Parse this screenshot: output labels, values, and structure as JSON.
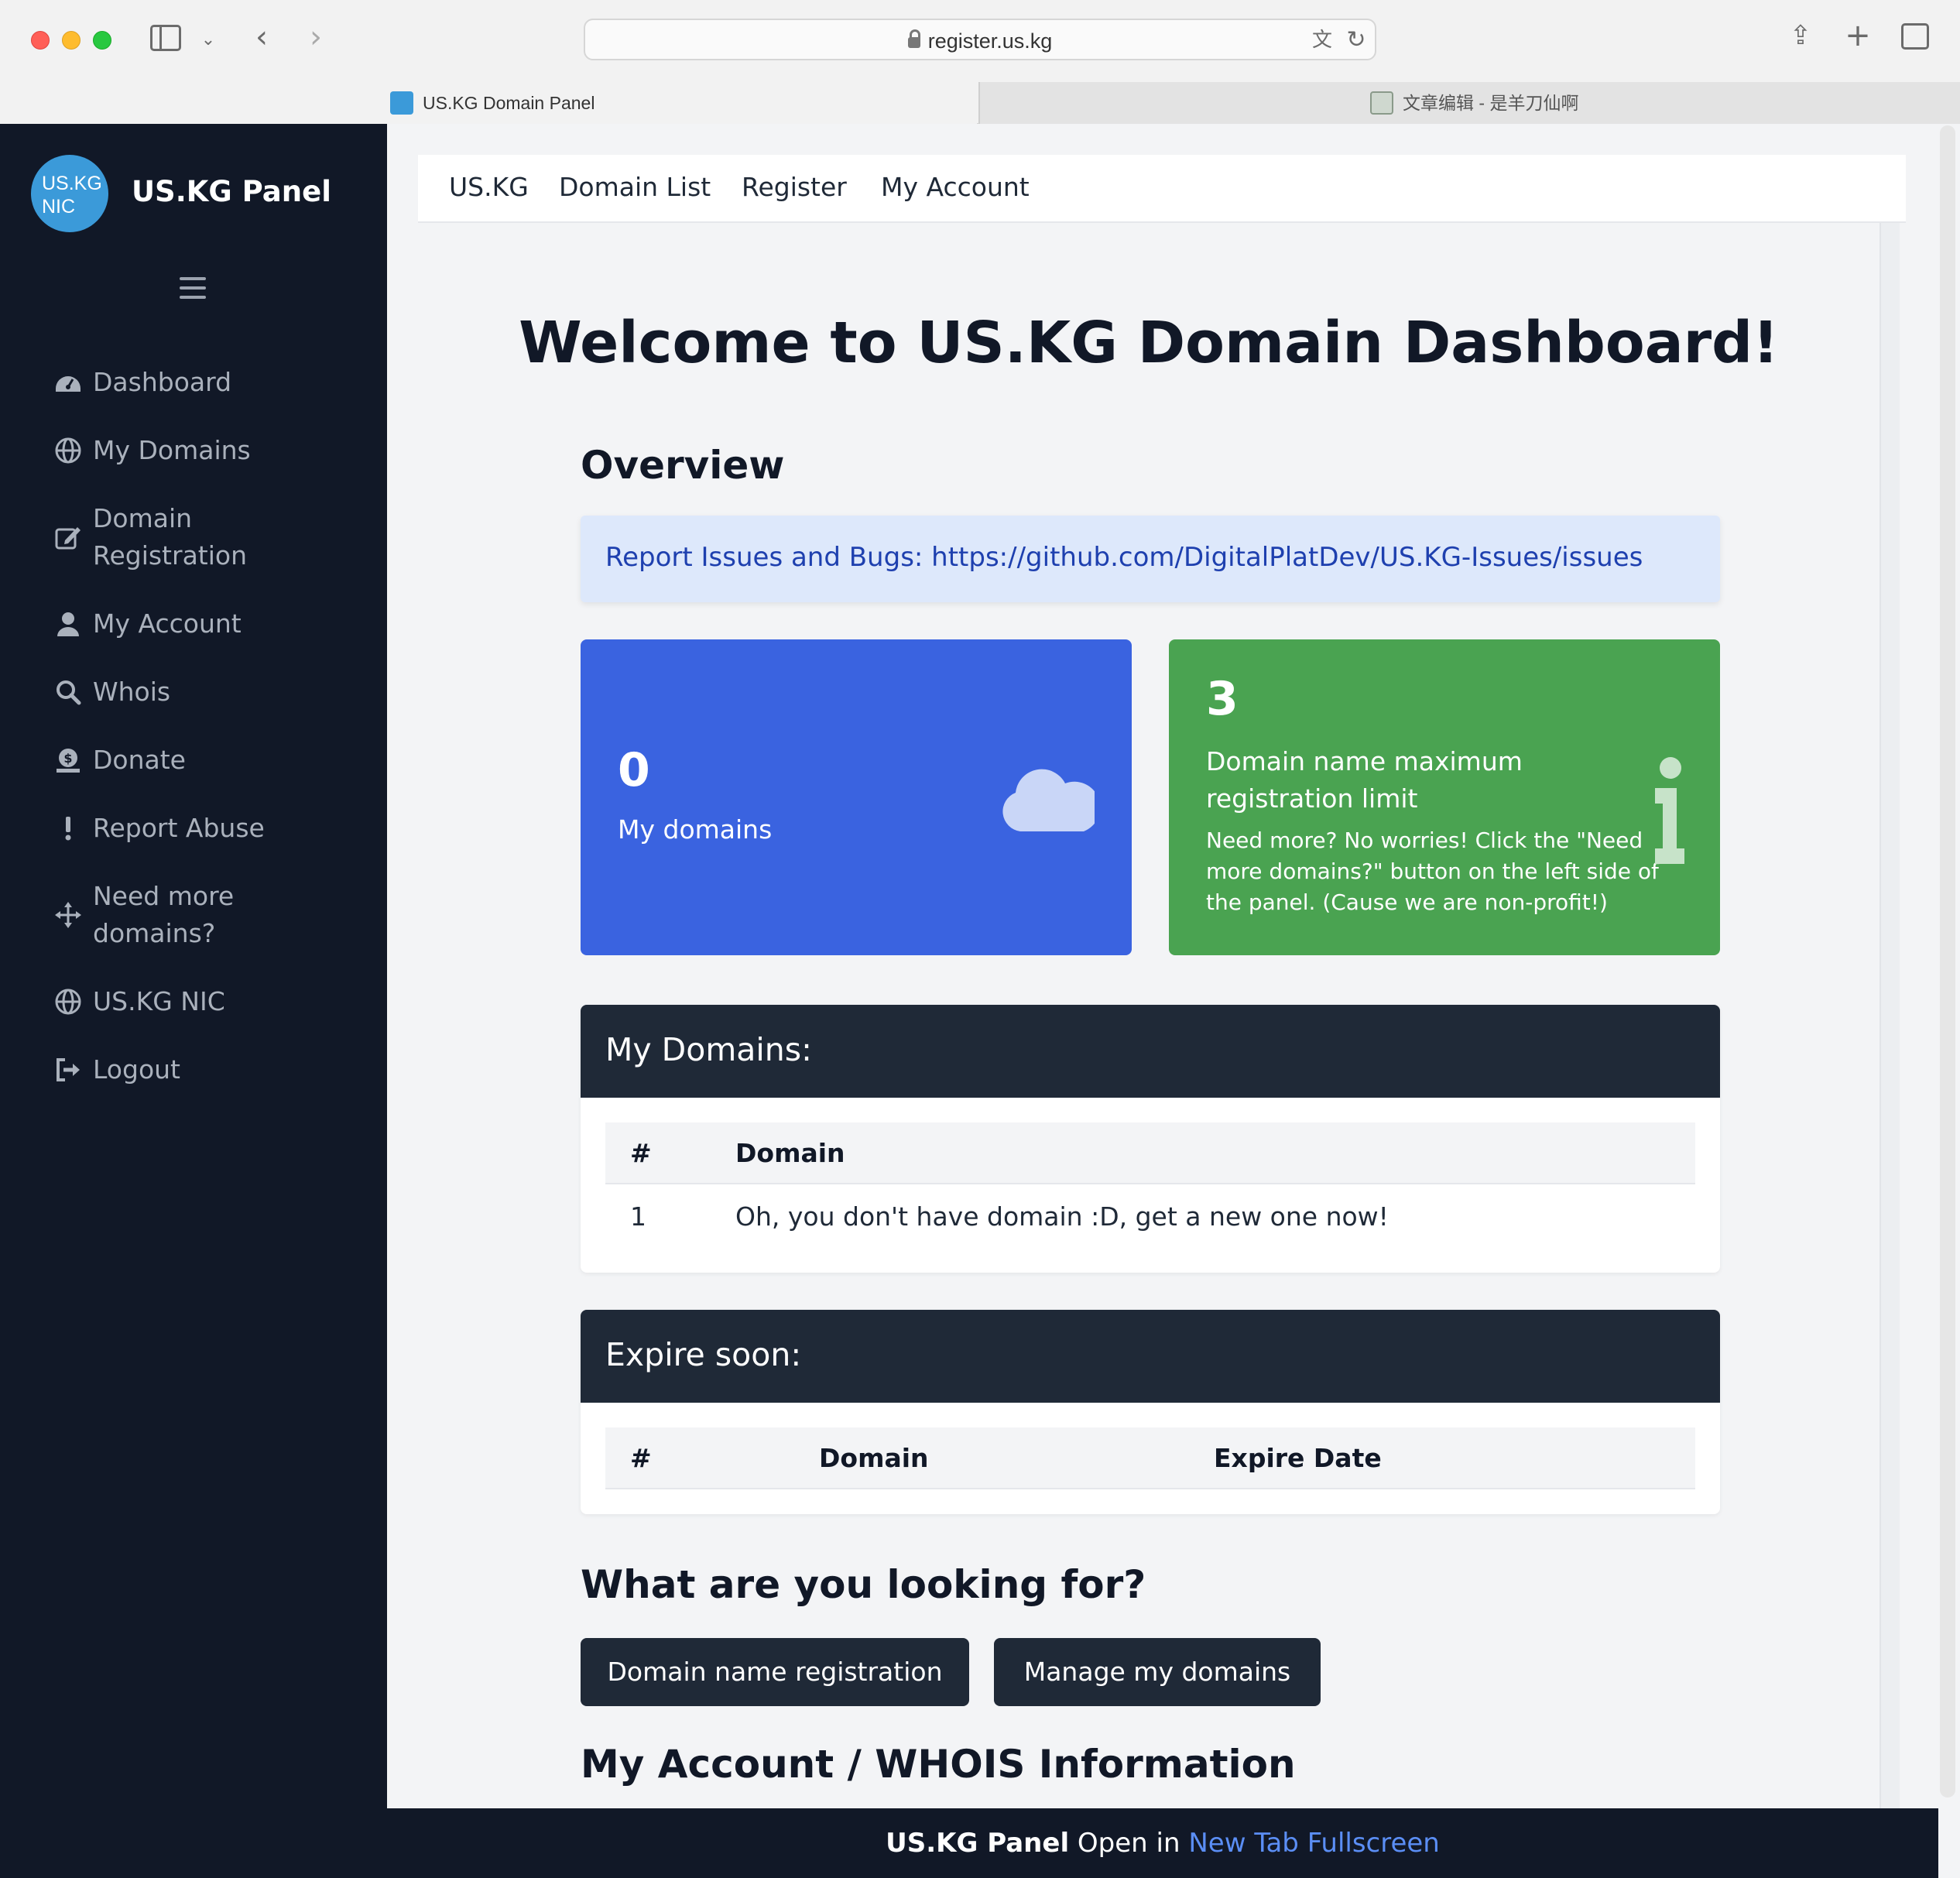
{
  "browser": {
    "url": "register.us.kg",
    "tabs": [
      {
        "title": "US.KG Domain Panel"
      },
      {
        "title": "文章编辑 - 是羊刀仙啊"
      }
    ]
  },
  "sidebar": {
    "logo_line1": "US.KG",
    "logo_line2": "NIC",
    "brand": "US.KG Panel",
    "items": [
      {
        "label": "Dashboard",
        "icon": "dashboard-icon"
      },
      {
        "label": "My Domains",
        "icon": "globe-icon"
      },
      {
        "label": "Domain Registration",
        "icon": "edit-icon"
      },
      {
        "label": "My Account",
        "icon": "user-icon"
      },
      {
        "label": "Whois",
        "icon": "search-icon"
      },
      {
        "label": "Donate",
        "icon": "donate-icon"
      },
      {
        "label": "Report Abuse",
        "icon": "exclamation-icon"
      },
      {
        "label": "Need more domains?",
        "icon": "arrows-icon"
      },
      {
        "label": "US.KG NIC",
        "icon": "globe-icon"
      },
      {
        "label": "Logout",
        "icon": "logout-icon"
      }
    ]
  },
  "topnav": {
    "links": [
      "US.KG",
      "Domain List",
      "Register",
      "My Account"
    ]
  },
  "main": {
    "title": "Welcome to US.KG Domain Dashboard!",
    "overview_heading": "Overview",
    "alert": "Report Issues and Bugs: https://github.com/DigitalPlatDev/US.KG-Issues/issues",
    "cards": {
      "domains_count": "0",
      "domains_label": "My domains",
      "limit_count": "3",
      "limit_label": "Domain name maximum registration limit",
      "limit_desc": "Need more? No worries! Click the \"Need more domains?\" button on the left side of the panel. (Cause we are non-profit!)"
    },
    "my_domains": {
      "heading": "My Domains:",
      "columns": [
        "#",
        "Domain"
      ],
      "rows": [
        {
          "num": "1",
          "domain": "Oh, you don't have domain :D, get a new one now!"
        }
      ]
    },
    "expire_soon": {
      "heading": "Expire soon:",
      "columns": [
        "#",
        "Domain",
        "Expire Date"
      ]
    },
    "looking_heading": "What are you looking for?",
    "buttons": [
      "Domain name registration",
      "Manage my domains"
    ],
    "account_heading": "My Account / WHOIS Information"
  },
  "footer": {
    "brand": "US.KG Panel",
    "text": "Open in",
    "link": "New Tab Fullscreen"
  },
  "colors": {
    "sidebar_bg": "#111827",
    "card_blue": "#3a63e0",
    "card_green": "#4aa351",
    "alert_bg": "#dde8fb"
  }
}
